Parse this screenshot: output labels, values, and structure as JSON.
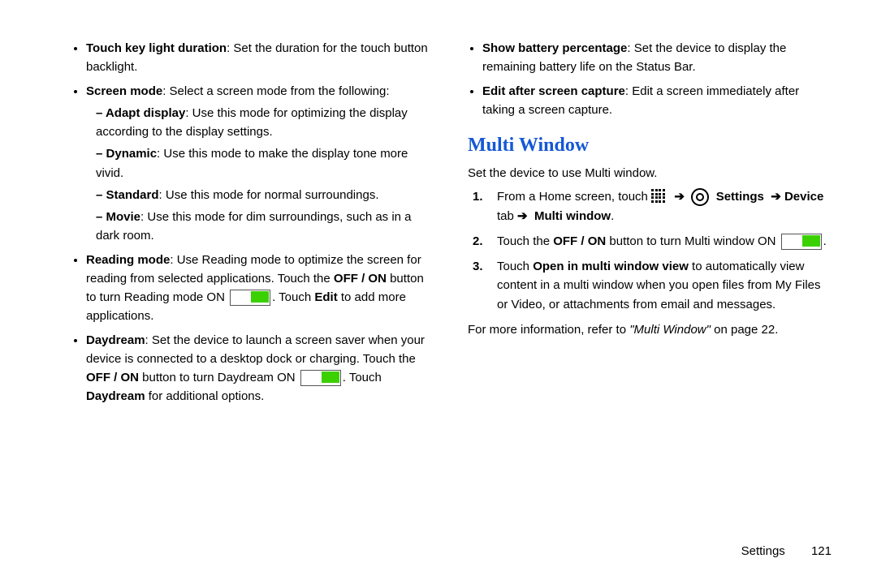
{
  "left": {
    "b1": {
      "lead": "Touch key light duration",
      "rest": ": Set the duration for the touch button backlight."
    },
    "b2": {
      "lead": "Screen mode",
      "rest": ": Select a screen mode from the following:"
    },
    "b2_sub": {
      "adapt": {
        "lead": "Adapt display",
        "rest": ": Use this mode for optimizing the display according to the display settings."
      },
      "dynamic": {
        "lead": "Dynamic",
        "rest": ": Use this mode to make the display tone more vivid."
      },
      "standard": {
        "lead": "Standard",
        "rest": ": Use this mode for normal surroundings."
      },
      "movie": {
        "lead": "Movie",
        "rest": ": Use this mode for dim surroundings, such as in a dark room."
      }
    },
    "b3": {
      "lead": "Reading mode",
      "part1": ": Use Reading mode to optimize the screen for reading from selected applications. Touch the ",
      "offon": "OFF / ON",
      "part2": " button to turn Reading mode ON ",
      "part3": ". Touch ",
      "edit": "Edit",
      "part4": " to add more applications."
    },
    "b4": {
      "lead": "Daydream",
      "part1": ": Set the device to launch a screen saver when your device is connected to a desktop dock or charging. Touch the ",
      "offon": "OFF / ON",
      "part2": " button to turn Daydream ON ",
      "part3": ". Touch ",
      "dd": "Daydream",
      "part4": " for additional options."
    }
  },
  "right": {
    "b1": {
      "lead": "Show battery percentage",
      "rest": ": Set the device to display the remaining battery life on the Status Bar."
    },
    "b2": {
      "lead": "Edit after screen capture",
      "rest": ": Edit a screen immediately after taking a screen capture."
    },
    "heading": "Multi Window",
    "intro": "Set the device to use Multi window.",
    "steps": {
      "s1": {
        "p1": "From a Home screen, touch ",
        "arrow": "➔",
        "settings": "Settings",
        "device": "Device",
        "tab": " tab ",
        "mw": "Multi window",
        "dot": "."
      },
      "s2": {
        "p1": "Touch the ",
        "offon": "OFF / ON",
        "p2": " button to turn Multi window ON ",
        "dot": "."
      },
      "s3": {
        "p1": "Touch ",
        "open": "Open in multi window view",
        "p2": " to automatically view content in a multi window when you open files from My Files or Video, or attachments from email and messages."
      }
    },
    "more": {
      "p1": "For more information, refer to ",
      "ref": "\"Multi Window\"",
      "p2": " on page 22."
    }
  },
  "footer": {
    "section": "Settings",
    "page": "121"
  }
}
